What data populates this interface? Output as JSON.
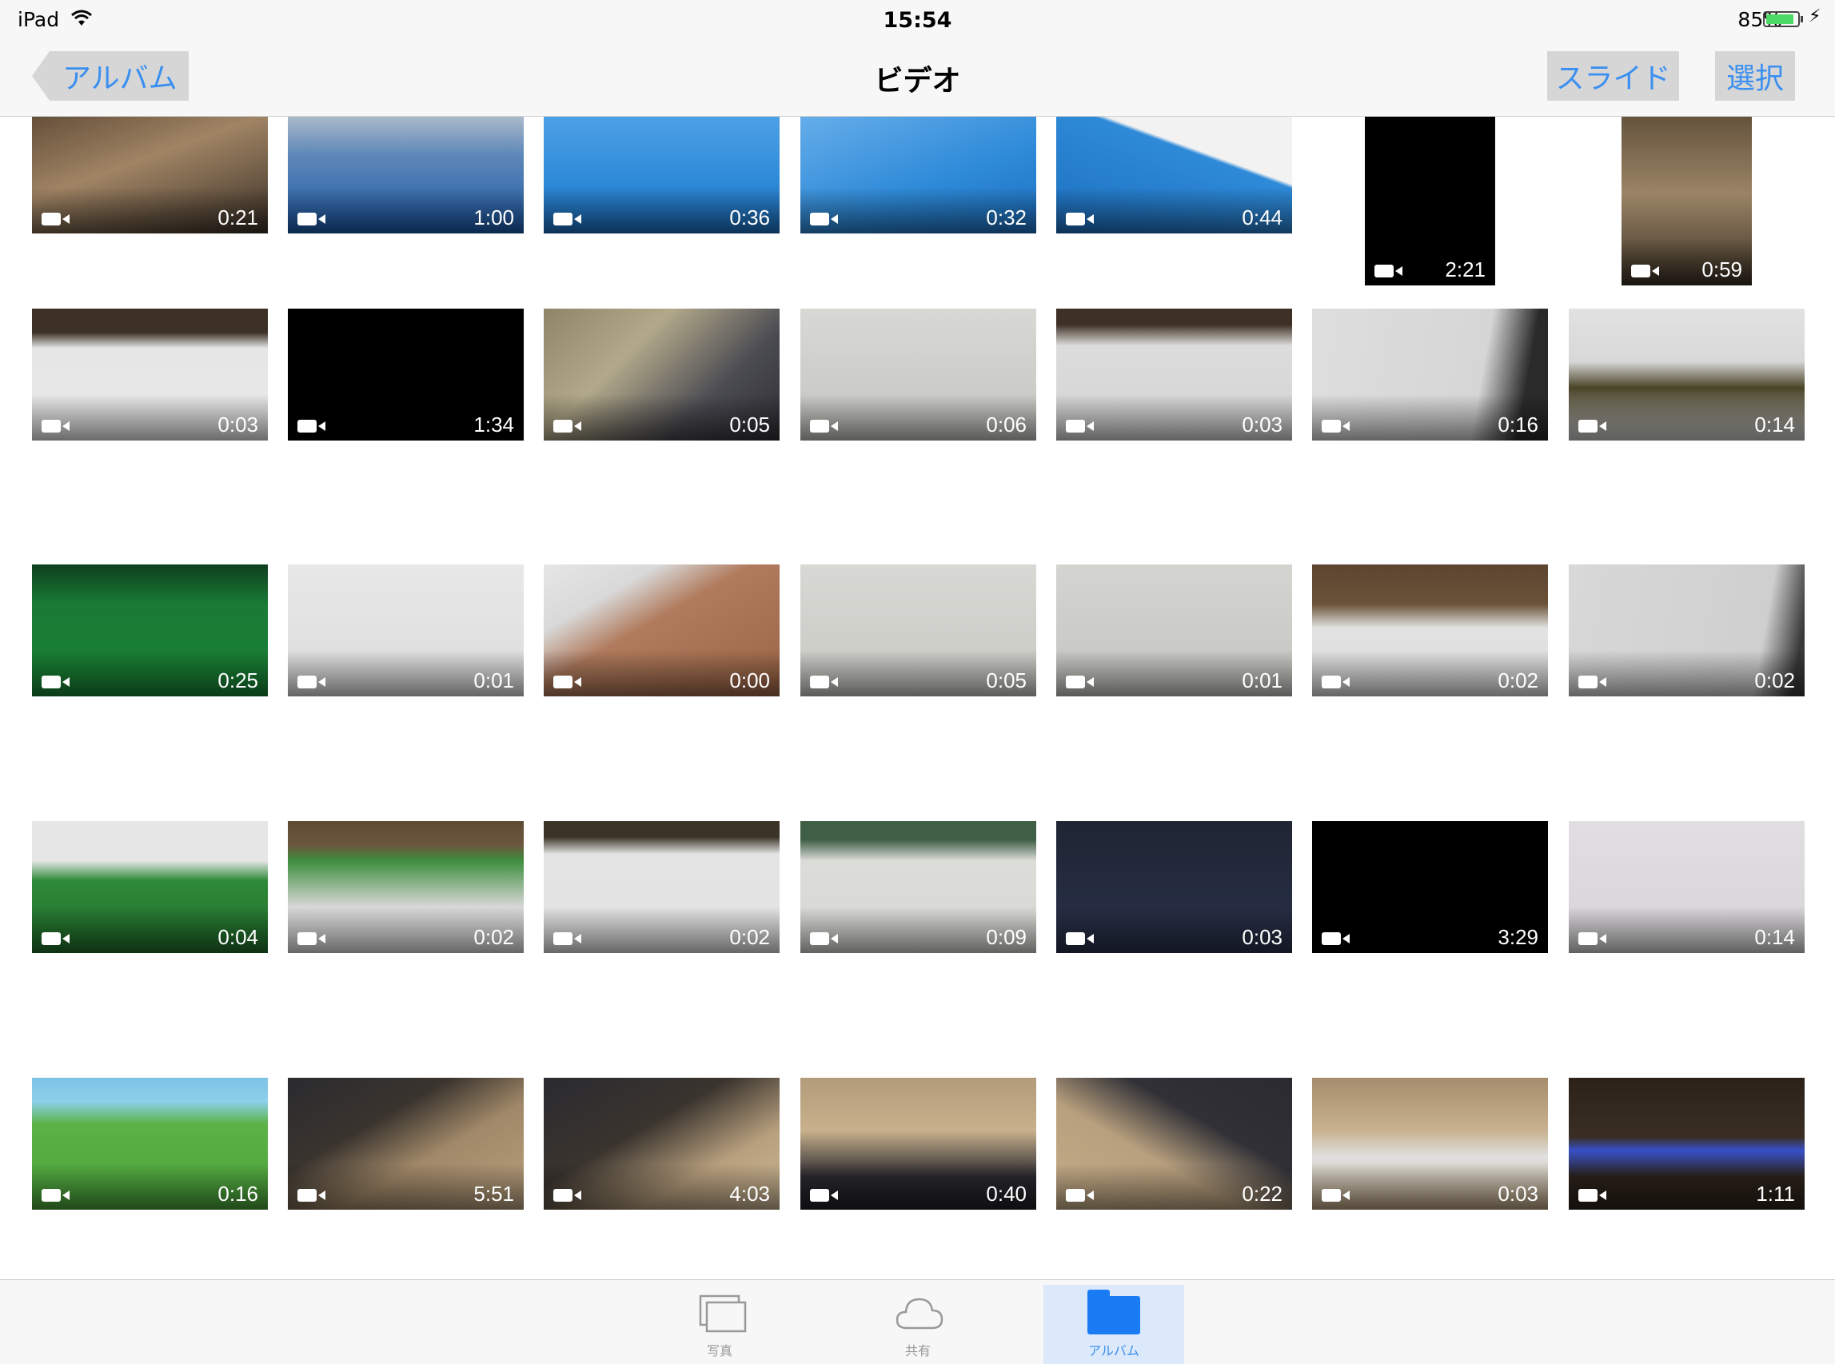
{
  "status_bar": {
    "device": "iPad",
    "time": "15:54",
    "battery": "85%"
  },
  "nav": {
    "back_label": "アルバム",
    "title": "ビデオ",
    "slide_label": "スライド",
    "select_label": "選択"
  },
  "colors": {
    "accent": "#3a8ff0",
    "tab_active_bg": "#dce9fb",
    "nav_bg": "#f7f7f7"
  },
  "videos": [
    [
      {
        "duration": "0:21",
        "bg": "linear-gradient(160deg,#5a4632 0%,#a08464 45%,#3a3026 100%)"
      },
      {
        "duration": "1:00",
        "bg": "linear-gradient(180deg,#c7ccd3 0%,#5f88b8 40%,#1c5aa8 100%)"
      },
      {
        "duration": "0:36",
        "bg": "linear-gradient(180deg,#54a6e8 0%,#2e8ad8 60%,#1d70c0 100%)"
      },
      {
        "duration": "0:32",
        "bg": "linear-gradient(160deg,#6cb2ec 0%,#2e8ad8 60%,#1d70c0 100%)"
      },
      {
        "duration": "0:44",
        "bg": "linear-gradient(200deg,#f2f2f2 0%,#f2f2f2 38%,#2e8ad8 40%,#1d70c0 100%)"
      },
      {
        "duration": "2:21",
        "bg": "#000000",
        "portrait": true
      },
      {
        "duration": "0:59",
        "bg": "linear-gradient(180deg,#5a4a34 0%,#9a8466 50%,#3b3024 100%)",
        "portrait": true
      }
    ],
    [
      {
        "duration": "0:03",
        "bg": "linear-gradient(180deg,#3d3126 0%,#3d3126 18%,#e6e6e6 30%,#e9e9e9 100%)"
      },
      {
        "duration": "1:34",
        "bg": "#000000"
      },
      {
        "duration": "0:05",
        "bg": "linear-gradient(135deg,#8f8468 0%,#b2a98a 35%,#4b4b52 70%,#2e2e34 100%)"
      },
      {
        "duration": "0:06",
        "bg": "linear-gradient(180deg,#d8d8d4 0%,#c4c5c0 100%)"
      },
      {
        "duration": "0:03",
        "bg": "linear-gradient(180deg,#3e3024 0%,#3e3024 12%,#dcdcdc 28%,#d4d4d4 100%)"
      },
      {
        "duration": "0:16",
        "bg": "linear-gradient(100deg,#dedede 0%,#d6d6d6 70%,#2a2a2a 88%,#2a2a2a 100%)"
      },
      {
        "duration": "0:14",
        "bg": "linear-gradient(180deg,#e2e2e2 0%,#d8d8d8 40%,#4a4428 60%,#d0d0d0 100%)"
      }
    ],
    [
      {
        "duration": "0:25",
        "bg": "linear-gradient(180deg,#0e3f1d 0%,#1a7a36 30%,#188233 100%)"
      },
      {
        "duration": "0:01",
        "bg": "linear-gradient(180deg,#e8e8e8 0%,#dcdcdc 100%)"
      },
      {
        "duration": "0:00",
        "bg": "linear-gradient(150deg,#e6e6e6 0%,#d9d9d9 25%,#b07a5c 45%,#9a6446 100%)"
      },
      {
        "duration": "0:05",
        "bg": "linear-gradient(180deg,#d8d8d4 0%,#c8c8c3 100%)"
      },
      {
        "duration": "0:01",
        "bg": "linear-gradient(180deg,#d4d4d0 0%,#c4c4c0 100%)"
      },
      {
        "duration": "0:02",
        "bg": "linear-gradient(180deg,#5c4630 0%,#6a5238 30%,#e2e2e2 48%,#dedede 100%)"
      },
      {
        "duration": "0:02",
        "bg": "linear-gradient(100deg,#d8d8d8 0%,#cfcfcf 80%,#383838 95%)"
      }
    ],
    [
      {
        "duration": "0:04",
        "bg": "linear-gradient(180deg,#e6e6e6 0%,#e6e6e6 30%,#2f8a3a 45%,#206d2a 100%)"
      },
      {
        "duration": "0:02",
        "bg": "linear-gradient(180deg,#5e4a34 0%,#6c563e 18%,#3d8d3e 30%,#d8d8d8 65%,#e2e2e2 100%)"
      },
      {
        "duration": "0:02",
        "bg": "linear-gradient(180deg,#3c3328 0%,#3c3328 12%,#e4e4e4 25%,#e2e2e2 100%)"
      },
      {
        "duration": "0:09",
        "bg": "linear-gradient(180deg,#3f5e46 0%,#3f5e46 14%,#dcdcd8 30%,#d8d8d4 100%)"
      },
      {
        "duration": "0:03",
        "bg": "linear-gradient(180deg,#1f2533 0%,#29314a 100%)"
      },
      {
        "duration": "3:29",
        "bg": "#000000"
      },
      {
        "duration": "0:14",
        "bg": "linear-gradient(180deg,#e0dee0 0%,#d6d4d6 100%)"
      }
    ],
    [
      {
        "duration": "0:16",
        "bg": "linear-gradient(180deg,#7ec2e6 0%,#8cd0ea 18%,#5bb346 35%,#4aa23a 100%)"
      },
      {
        "duration": "5:51",
        "bg": "linear-gradient(150deg,#2a2a2e 0%,#3a342e 35%,#a08868 60%,#b8a07e 100%)"
      },
      {
        "duration": "4:03",
        "bg": "linear-gradient(150deg,#2a2a30 0%,#3a342e 40%,#b8a07e 70%,#cbb694 100%)"
      },
      {
        "duration": "0:40",
        "bg": "linear-gradient(180deg,#b39c7a 0%,#c8b08c 40%,#2a2a30 75%,#202024 100%)"
      },
      {
        "duration": "0:22",
        "bg": "linear-gradient(210deg,#2a2a30 0%,#303036 35%,#b8a07e 60%,#c4ac88 100%)"
      },
      {
        "duration": "0:03",
        "bg": "linear-gradient(180deg,#a58c6c 0%,#c8b290 40%,#e0e0e0 60%,#b8a07e 100%)"
      },
      {
        "duration": "1:11",
        "bg": "linear-gradient(180deg,#2c221a 0%,#3a2e24 45%,#3850c8 55%,#2c221a 75%,#2c221a 100%)"
      }
    ]
  ],
  "tabs": [
    {
      "label": "写真",
      "icon": "photos-icon"
    },
    {
      "label": "共有",
      "icon": "cloud-icon"
    },
    {
      "label": "アルバム",
      "icon": "album-icon",
      "active": true
    }
  ]
}
